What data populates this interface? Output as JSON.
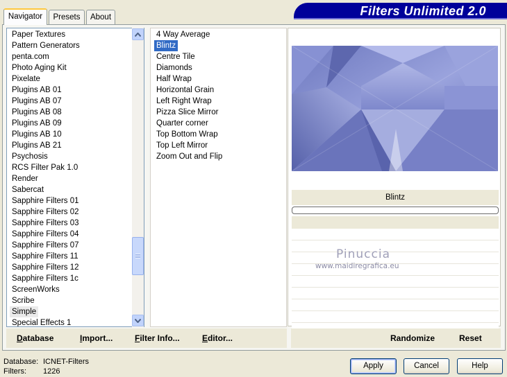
{
  "tabs": [
    "Navigator",
    "Presets",
    "About"
  ],
  "banner_title": "Filters Unlimited 2.0",
  "categories": [
    "Paper Textures",
    "Pattern Generators",
    "penta.com",
    "Photo Aging Kit",
    "Pixelate",
    "Plugins AB 01",
    "Plugins AB 07",
    "Plugins AB 08",
    "Plugins AB 09",
    "Plugins AB 10",
    "Plugins AB 21",
    "Psychosis",
    "RCS Filter Pak 1.0",
    "Render",
    "Sabercat",
    "Sapphire Filters 01",
    "Sapphire Filters 02",
    "Sapphire Filters 03",
    "Sapphire Filters 04",
    "Sapphire Filters 07",
    "Sapphire Filters 11",
    "Sapphire Filters 12",
    "Sapphire Filters 1c",
    "ScreenWorks",
    "Scribe",
    "Simple",
    "Special Effects 1"
  ],
  "highlighted_category": "Simple",
  "filters": [
    "4 Way Average",
    "Blintz",
    "Centre Tile",
    "Diamonds",
    "Half Wrap",
    "Horizontal Grain",
    "Left Right Wrap",
    "Pizza Slice Mirror",
    "Quarter corner",
    "Top Bottom Wrap",
    "Top Left Mirror",
    "Zoom Out and Flip"
  ],
  "selected_filter": "Blintz",
  "preview": {
    "filter_name": "Blintz"
  },
  "watermark": {
    "name": "Pinuccia",
    "url": "www.maidiregrafica.eu"
  },
  "left_actions": {
    "database": "Database",
    "import": "Import...",
    "filter_info": "Filter Info...",
    "editor": "Editor..."
  },
  "right_actions": {
    "randomize": "Randomize",
    "reset": "Reset"
  },
  "footer": {
    "database_label": "Database:",
    "database_value": "ICNET-Filters",
    "filters_label": "Filters:",
    "filters_value": "1226"
  },
  "buttons": {
    "apply": "Apply",
    "cancel": "Cancel",
    "help": "Help"
  },
  "colors": {
    "banner": "#00009a",
    "selection": "#316ac5",
    "preview_base": "#8e97d4"
  },
  "icons": [
    "scroll-up-icon",
    "scroll-down-icon",
    "scroll-grip-icon"
  ]
}
